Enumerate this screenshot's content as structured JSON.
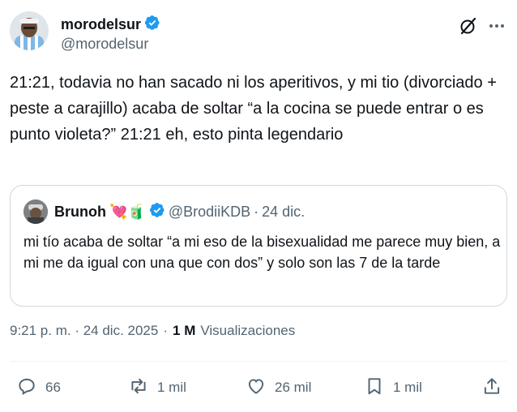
{
  "author": {
    "display_name": "morodelsur",
    "handle": "@morodelsur"
  },
  "tweet": {
    "text": "21:21, todavia no han sacado ni los aperitivos, y mi tio (divorciado + peste a carajillo) acaba de soltar “a la cocina se puede entrar o es punto violeta?” 21:21 eh, esto pinta legendario"
  },
  "quote": {
    "display_name": "Brunoh",
    "name_emojis": "💘🧃",
    "handle": "@BrodiiKDB",
    "separator": "·",
    "date": "24 dic.",
    "text": "mi tío acaba de soltar “a mi eso de la bisexualidad me parece muy bien, a mi me da igual con una que con dos” y solo son las 7 de la tarde"
  },
  "meta": {
    "timestamp": "9:21 p. m. · 24 dic. 2025",
    "separator": "·",
    "views_count": "1 M",
    "views_label": "Visualizaciones"
  },
  "actions": {
    "replies": "66",
    "reposts": "1 mil",
    "likes": "26 mil",
    "bookmarks": "1 mil"
  },
  "colors": {
    "text": "#0f1419",
    "secondary": "#536471",
    "verified": "#1d9bf0",
    "border": "#cfd9de"
  }
}
